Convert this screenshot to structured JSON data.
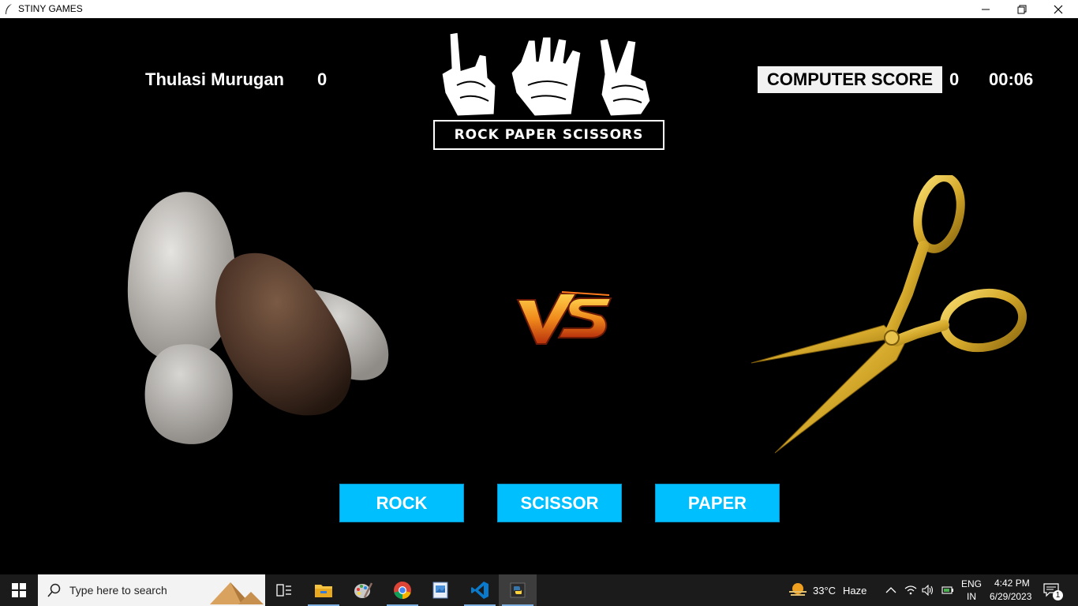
{
  "window": {
    "title": "STINY GAMES",
    "controls": {
      "minimize": "minimize-icon",
      "restore": "restore-icon",
      "close": "close-icon"
    }
  },
  "game": {
    "player_name": "Thulasi Murugan",
    "player_score": "0",
    "computer_label": "COMPUTER SCORE",
    "computer_score": "0",
    "timer": "00:06",
    "logo_text": "ROCK PAPER SCISSORS",
    "player_choice": "rock-image",
    "computer_choice": "scissors-image",
    "vs_text": "VS",
    "buttons": {
      "rock": "ROCK",
      "scissor": "SCISSOR",
      "paper": "PAPER"
    },
    "colors": {
      "button_bg": "#00bfff",
      "background": "#000000",
      "scissors_gold": "#d4a82a"
    }
  },
  "taskbar": {
    "search_placeholder": "Type here to search",
    "apps": [
      "task-view-icon",
      "file-explorer-icon",
      "paint-icon",
      "chrome-icon",
      "photos-icon",
      "vscode-icon",
      "python-icon"
    ],
    "weather": {
      "temp": "33°C",
      "condition": "Haze"
    },
    "language": {
      "lang": "ENG",
      "region": "IN"
    },
    "time": "4:42 PM",
    "date": "6/29/2023",
    "notification_count": "1"
  }
}
